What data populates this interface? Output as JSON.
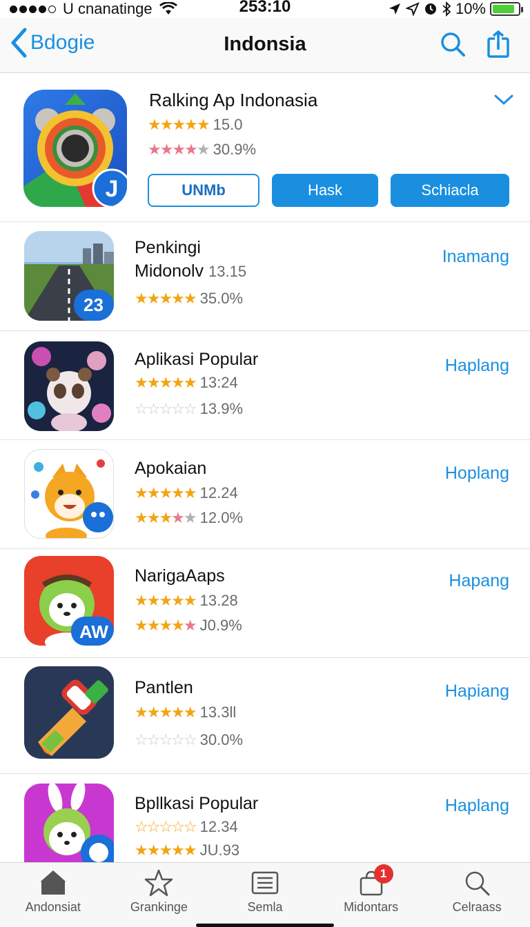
{
  "status_bar": {
    "carrier": "U cnanatinge",
    "time": "253:10",
    "battery_percent": "10%",
    "battery_level": 0.85
  },
  "nav": {
    "back_label": "Bdogie",
    "title": "Indonsia",
    "accent_color": "#1a8fe0"
  },
  "featured": {
    "title": "Ralking Ap Indonasia",
    "rating_value": "15.0",
    "rating2_value": "30.9%",
    "badge_letter": "J",
    "buttons": [
      "UNMb",
      "Hask",
      "Schiacla"
    ]
  },
  "apps": [
    {
      "name": "Penkingi",
      "subname": "Midonolv",
      "version": "13.15",
      "rating_value": "35.0%",
      "action": "Inamang",
      "badge": "23"
    },
    {
      "name": "Aplikasi Popular",
      "version": "13:24",
      "rating_value": "13.9%",
      "action": "Haplang"
    },
    {
      "name": "Apokaian",
      "version": "12.24",
      "rating_value": "12.0%",
      "action": "Hoplang"
    },
    {
      "name": "NarigaAaps",
      "version": "13.28",
      "rating_value": "J0.9%",
      "action": "Hapang",
      "badge": "AW"
    },
    {
      "name": "Pantlen",
      "version": "13.3ll",
      "rating_value": "30.0%",
      "action": "Hapiang"
    },
    {
      "name": "Bpllkasi Popular",
      "version": "12.34",
      "rating_value": "JU.93",
      "action": "Haplang"
    }
  ],
  "tabs": [
    {
      "label": "Andonsiat",
      "icon": "home-icon"
    },
    {
      "label": "Grankinge",
      "icon": "star-icon"
    },
    {
      "label": "Semla",
      "icon": "list-icon"
    },
    {
      "label": "Midontars",
      "icon": "bag-icon",
      "badge": "1"
    },
    {
      "label": "Celraass",
      "icon": "search-icon"
    }
  ]
}
